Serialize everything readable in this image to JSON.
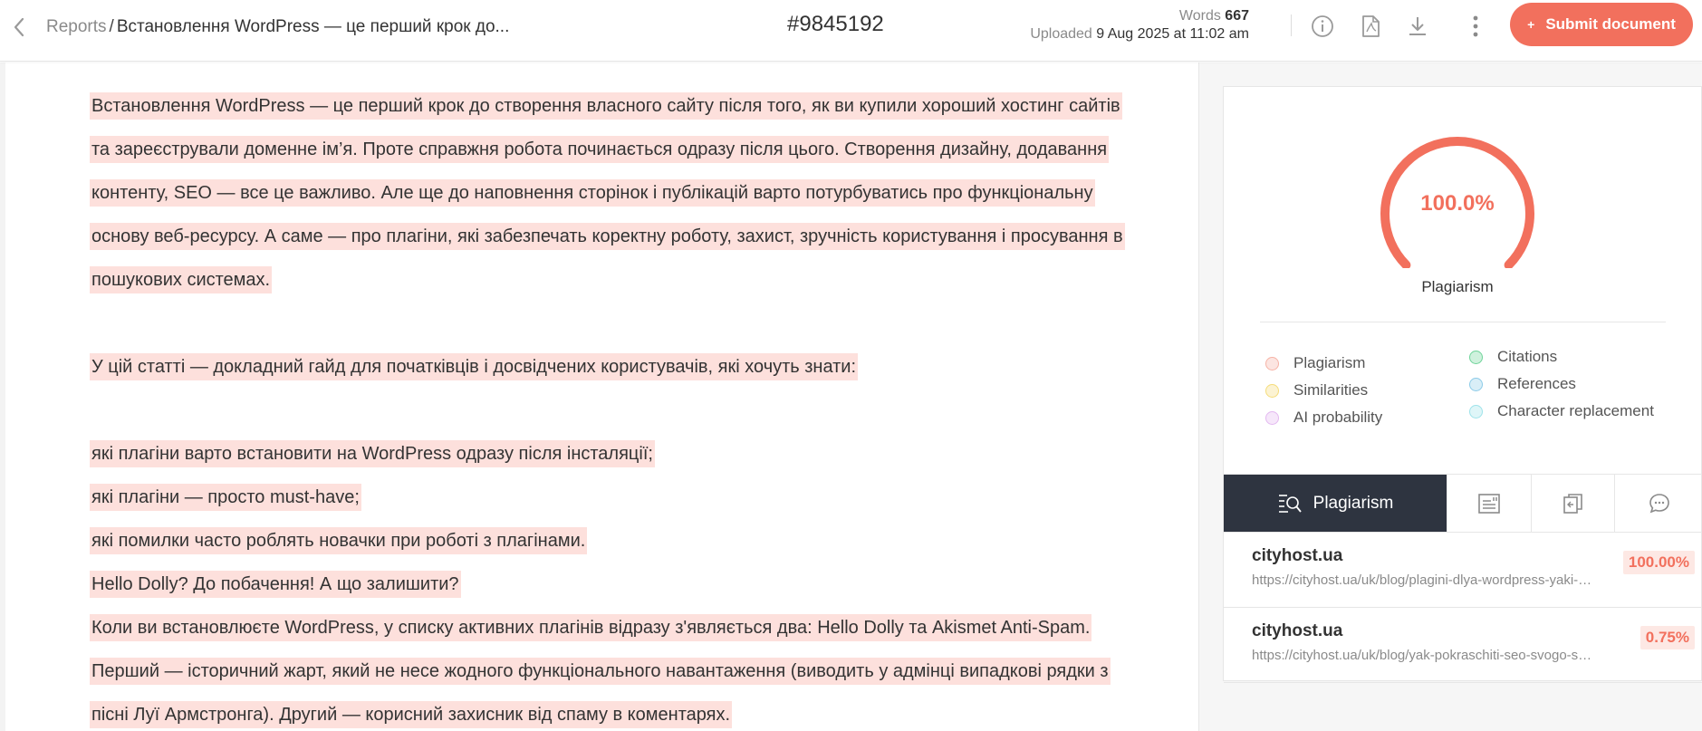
{
  "header": {
    "breadcrumb_root": "Reports",
    "breadcrumb_sep": "/",
    "breadcrumb_current": "Встановлення WordPress — це перший крок до...",
    "doc_id": "#9845192",
    "words_label": "Words",
    "words_value": "667",
    "uploaded_label": "Uploaded",
    "uploaded_value": "9 Aug 2025 at 11:02 am",
    "submit_plus": "+",
    "submit_label": "Submit document",
    "icons": [
      "chevron-left-icon",
      "info-icon",
      "pdf-icon",
      "download-icon",
      "more-vertical-icon"
    ]
  },
  "document": {
    "para1": "Встановлення WordPress — це перший крок до створення власного сайту після того, як ви купили хороший хостинг сайтів та зареєстрували доменне ім’я. Проте справжня робота починається одразу після цього. Створення дизайну, додавання контенту, SEO — все це важливо. Але ще до наповнення сторінок і публікацій варто потурбуватись про функціональну основу веб-ресурсу. А саме — про плагіни, які забезпечать коректну роботу, захист, зручність користування і просування в пошукових системах.",
    "para2": "У цій статті — докладний гайд для початківців і досвідчених користувачів, які хочуть знати:",
    "list": [
      "які плагіни варто встановити на WordPress одразу після інсталяції;",
      "які плагіни — просто must-have;",
      "які помилки часто роблять новачки при роботі з плагінами.",
      "Hello Dolly? До побачення! А що залишити?"
    ],
    "para3": "Коли ви встановлюєте WordPress, у списку активних плагінів відразу з'являється два: Hello Dolly та Akismet Anti-Spam. Перший — історичний жарт, який не несе жодного функціонального навантаження (виводить у адмінці випадкові рядки з пісні Луї Армстронга). Другий — корисний захисник від спаму в коментарях."
  },
  "summary": {
    "score": "100.0%",
    "score_fraction": 1.0,
    "score_label": "Plagiarism",
    "accent_color": "#f2705d",
    "legend": [
      {
        "label": "Plagiarism",
        "color": "#f6b2a5"
      },
      {
        "label": "Similarities",
        "color": "#f5dc7a"
      },
      {
        "label": "AI probability",
        "color": "#e3b8f0"
      },
      {
        "label": "Citations",
        "color": "#6fd49a"
      },
      {
        "label": "References",
        "color": "#8ccbe8"
      },
      {
        "label": "Character replacement",
        "color": "#9ee3ea"
      }
    ]
  },
  "tabs": {
    "active_label": "Plagiarism",
    "icons": [
      "plagiarism-search-icon",
      "document-list-icon",
      "copy-compare-icon",
      "comment-icon"
    ]
  },
  "sources": [
    {
      "name": "cityhost.ua",
      "url": "https://cityhost.ua/uk/blog/plagini-dlya-wordpress-yaki-vstanovyty",
      "percent": "100.00%"
    },
    {
      "name": "cityhost.ua",
      "url": "https://cityhost.ua/uk/blog/yak-pokraschiti-seo-svogo-saytu",
      "percent": "0.75%"
    }
  ]
}
